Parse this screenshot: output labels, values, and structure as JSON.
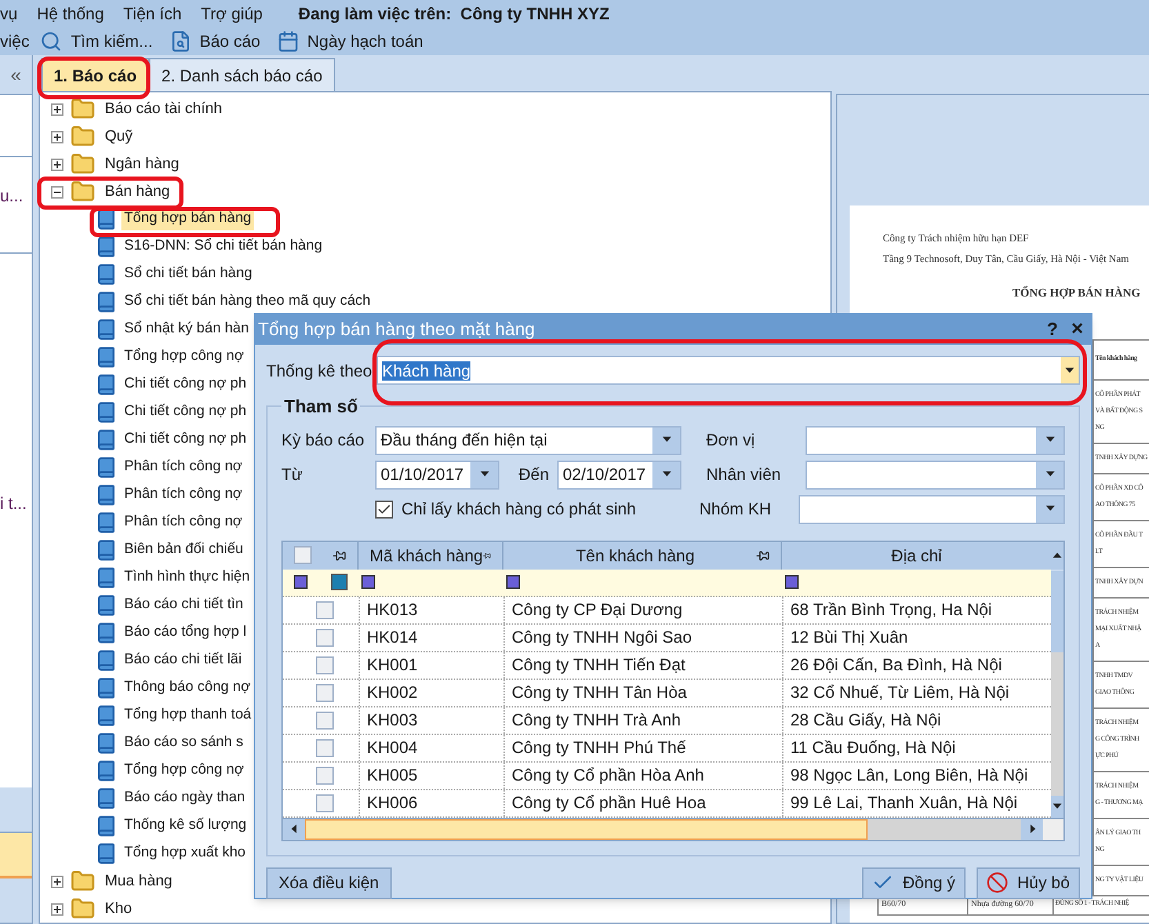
{
  "menu": {
    "items": [
      "vụ",
      "Hệ thống",
      "Tiện ích",
      "Trợ giúp"
    ],
    "workspace": "Đang làm việc trên:  Công ty TNHH XYZ"
  },
  "toolbar": {
    "items": [
      {
        "label": "việc"
      },
      {
        "label": "Tìm kiếm..."
      },
      {
        "label": "Báo cáo"
      },
      {
        "label": "Ngày hạch toán"
      }
    ]
  },
  "side_panel": {
    "collapse": "«",
    "items": [
      "u...",
      "i t..."
    ],
    "sections": [
      {
        "selected": false
      },
      {
        "selected": true
      },
      {
        "selected": false
      }
    ]
  },
  "tabs": [
    {
      "label": "1. Báo cáo",
      "selected": true
    },
    {
      "label": "2. Danh sách báo cáo",
      "selected": false
    }
  ],
  "tree": [
    {
      "label": "Báo cáo tài chính",
      "kind": "folder",
      "expanded": false,
      "selected": false
    },
    {
      "label": "Quỹ",
      "kind": "folder",
      "expanded": false,
      "selected": false
    },
    {
      "label": "Ngân hàng",
      "kind": "folder",
      "expanded": false,
      "selected": false
    },
    {
      "label": "Bán hàng",
      "kind": "folder",
      "expanded": true,
      "selected": false,
      "children": [
        {
          "label": "Tổng hợp bán hàng",
          "kind": "report",
          "selected": true
        },
        {
          "label": "S16-DNN: Sổ chi tiết bán hàng",
          "kind": "report",
          "selected": false
        },
        {
          "label": "Sổ chi tiết bán hàng",
          "kind": "report",
          "selected": false
        },
        {
          "label": "Sổ chi tiết bán hàng theo mã quy cách",
          "kind": "report",
          "selected": false
        },
        {
          "label": "Sổ nhật ký bán hàn",
          "kind": "report",
          "selected": false
        },
        {
          "label": "Tổng hợp công nợ",
          "kind": "report",
          "selected": false
        },
        {
          "label": "Chi tiết công nợ ph",
          "kind": "report",
          "selected": false
        },
        {
          "label": "Chi tiết công nợ ph",
          "kind": "report",
          "selected": false
        },
        {
          "label": "Chi tiết công nợ ph",
          "kind": "report",
          "selected": false
        },
        {
          "label": "Phân tích công nợ",
          "kind": "report",
          "selected": false
        },
        {
          "label": "Phân tích công nợ",
          "kind": "report",
          "selected": false
        },
        {
          "label": "Phân tích công nợ",
          "kind": "report",
          "selected": false
        },
        {
          "label": "Biên bản đối chiếu",
          "kind": "report",
          "selected": false
        },
        {
          "label": "Tình hình thực hiện",
          "kind": "report",
          "selected": false
        },
        {
          "label": "Báo cáo chi tiết tìn",
          "kind": "report",
          "selected": false
        },
        {
          "label": "Báo cáo tổng hợp l",
          "kind": "report",
          "selected": false
        },
        {
          "label": "Báo cáo chi tiết lãi",
          "kind": "report",
          "selected": false
        },
        {
          "label": "Thông báo công nợ",
          "kind": "report",
          "selected": false
        },
        {
          "label": "Tổng hợp thanh toá",
          "kind": "report",
          "selected": false
        },
        {
          "label": "Báo cáo so sánh s",
          "kind": "report",
          "selected": false
        },
        {
          "label": "Tổng hợp công nợ",
          "kind": "report",
          "selected": false
        },
        {
          "label": "Báo cáo ngày than",
          "kind": "report",
          "selected": false
        },
        {
          "label": "Thống kê số lượng",
          "kind": "report",
          "selected": false
        },
        {
          "label": "Tổng hợp xuất kho",
          "kind": "report",
          "selected": false
        }
      ]
    },
    {
      "label": "Mua hàng",
      "kind": "folder",
      "expanded": false,
      "selected": false
    },
    {
      "label": "Kho",
      "kind": "folder",
      "expanded": false,
      "selected": false
    }
  ],
  "report_preview": {
    "company": "Công ty Trách nhiệm hữu hạn DEF",
    "address": "Tầng 9 Technosoft, Duy Tân, Cầu Giấy, Hà Nội - Việt Nam",
    "title": "TỔNG HỢP BÁN HÀNG",
    "column_3_header": "Tên khách hàng",
    "rows": [
      {
        "lines": [
          "CÔ PHẦN PHÁT",
          "VÀ BẤT ĐỘNG S",
          "NG"
        ]
      },
      {
        "lines": [
          "TNHH XÂY DỰNG"
        ]
      },
      {
        "lines": [
          "CÔ PHẦN XD CÔ",
          "AO THÔNG 75"
        ]
      },
      {
        "lines": [
          "CÔ PHẦN ĐẦU T",
          "I.T"
        ]
      },
      {
        "lines": [
          "TNHH XÂY DỰN"
        ]
      },
      {
        "lines": [
          "TRÁCH NHIỆM",
          "MẠI XUẤT NHẬ",
          "A"
        ]
      },
      {
        "lines": [
          "TNHH TMDV",
          "GIAO THÔNG"
        ]
      },
      {
        "lines": [
          "TRÁCH NHIỆM",
          "G CÔNG TRÌNH",
          "ỰC PHÚ"
        ]
      },
      {
        "lines": [
          "TRÁCH NHIỆM",
          "G - THƯƠNG MẠ"
        ]
      },
      {
        "lines": [
          "ÂN LÝ GIAO TH",
          "NG"
        ]
      },
      {
        "lines": [
          "NG TY VẬT LIỆU"
        ]
      }
    ],
    "last_row": {
      "column_1": "B60/70",
      "column_2": "Nhựa đường 60/70",
      "column_3": "ĐÚNG SỐ 1 - TRÁCH NHIỆ"
    }
  },
  "dialog": {
    "title": "Tổng hợp bán hàng theo mặt hàng",
    "help": "?",
    "close": "×",
    "group_by": {
      "label": "Thống kê theo",
      "value": "Khách hàng"
    },
    "params": {
      "title": "Tham số",
      "period": {
        "label": "Kỳ báo cáo",
        "value": "Đầu tháng đến hiện tại"
      },
      "from": {
        "label": "Từ",
        "value": "01/10/2017"
      },
      "to": {
        "label": "Đến",
        "value": "02/10/2017"
      },
      "only_active": {
        "label": "Chỉ lấy khách hàng có phát sinh",
        "checked": true
      },
      "unit": {
        "label": "Đơn vị"
      },
      "employee": {
        "label": "Nhân viên"
      },
      "customer_group": {
        "label": "Nhóm KH"
      }
    },
    "grid": {
      "columns": [
        "Mã khách hàng",
        "Tên khách hàng",
        "Địa chỉ"
      ],
      "all_checked": false,
      "rows": [
        {
          "code": "HK013",
          "name": "Công ty CP Đại Dương",
          "address": "68 Trần Bình Trọng, Ha Nội",
          "checked": false
        },
        {
          "code": "HK014",
          "name": "Công ty TNHH Ngôi Sao",
          "address": "12 Bùi Thị Xuân",
          "checked": false
        },
        {
          "code": "KH001",
          "name": "Công ty TNHH Tiến Đạt",
          "address": "26 Đội Cấn, Ba Đình, Hà Nội",
          "checked": false
        },
        {
          "code": "KH002",
          "name": "Công ty TNHH Tân Hòa",
          "address": "32 Cổ Nhuế, Từ Liêm, Hà Nội",
          "checked": false
        },
        {
          "code": "KH003",
          "name": "Công ty TNHH Trà Anh",
          "address": "28 Cầu Giấy, Hà Nội",
          "checked": false
        },
        {
          "code": "KH004",
          "name": "Công ty TNHH Phú Thế",
          "address": "11 Cầu Đuống, Hà Nội",
          "checked": false
        },
        {
          "code": "KH005",
          "name": "Công ty Cổ phần Hòa Anh",
          "address": "98 Ngọc Lân, Long Biên, Hà Nội",
          "checked": false
        },
        {
          "code": "KH006",
          "name": "Công ty Cổ phần Huê Hoa",
          "address": "99 Lê Lai, Thanh Xuân, Hà Nội",
          "checked": false
        }
      ]
    },
    "buttons": {
      "clear": "Xóa điều kiện",
      "ok": "Đồng ý",
      "cancel": "Hủy bỏ"
    }
  }
}
